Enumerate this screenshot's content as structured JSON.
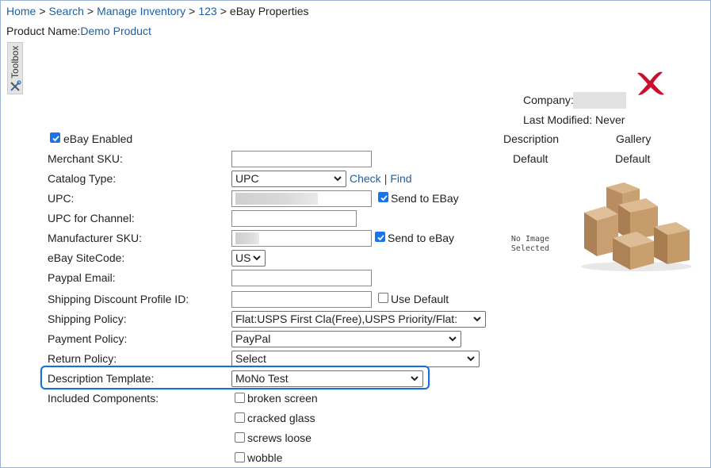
{
  "breadcrumb": {
    "items": [
      "Home",
      "Search",
      "Manage Inventory",
      "123"
    ],
    "separator": ">",
    "current": "eBay Properties"
  },
  "product": {
    "label": "Product Name:",
    "value": "Demo Product"
  },
  "toolbox": {
    "label": "Toolbox",
    "icon": "tools-icon"
  },
  "meta": {
    "company_label": "Company:",
    "last_modified": "Last Modified: Never"
  },
  "form": {
    "ebay_enabled": {
      "label": "eBay Enabled",
      "checked": true
    },
    "merchant_sku": {
      "label": "Merchant SKU:",
      "value": ""
    },
    "catalog_type": {
      "label": "Catalog Type:",
      "selected": "UPC",
      "check_link": "Check",
      "link_sep": "|",
      "find_link": "Find"
    },
    "upc": {
      "label": "UPC:",
      "send_label": "Send to EBay",
      "send_checked": true
    },
    "upc_channel": {
      "label": "UPC for Channel:",
      "value": ""
    },
    "manufacturer_sku": {
      "label": "Manufacturer SKU:",
      "send_label": "Send to eBay",
      "send_checked": true
    },
    "ebay_sitecode": {
      "label": "eBay SiteCode:",
      "selected": "US"
    },
    "paypal_email": {
      "label": "Paypal Email:",
      "value": ""
    },
    "shipping_discount": {
      "label": "Shipping Discount Profile ID:",
      "value": "",
      "use_default_label": "Use Default",
      "use_default_checked": false
    },
    "shipping_policy": {
      "label": "Shipping Policy:",
      "selected": "Flat:USPS First Cla(Free),USPS Priority/Flat:"
    },
    "payment_policy": {
      "label": "Payment Policy:",
      "selected": "PayPal"
    },
    "return_policy": {
      "label": "Return Policy:",
      "selected": "Select"
    },
    "description_template": {
      "label": "Description Template:",
      "selected": "MoNo Test"
    },
    "included_components": {
      "label": "Included Components:",
      "options": [
        {
          "label": "broken screen",
          "checked": false
        },
        {
          "label": "cracked glass",
          "checked": false
        },
        {
          "label": "screws loose",
          "checked": false
        },
        {
          "label": "wobble",
          "checked": false
        }
      ]
    }
  },
  "images": {
    "description_header": "Description",
    "gallery_header": "Gallery",
    "description_value": "Default",
    "gallery_value": "Default",
    "no_image_line1": "No Image",
    "no_image_line2": "Selected"
  },
  "colors": {
    "link": "#1f5fa0",
    "highlight": "#1a6fd6",
    "checkbox": "#1a73e8",
    "close_x": "#c8102e"
  }
}
